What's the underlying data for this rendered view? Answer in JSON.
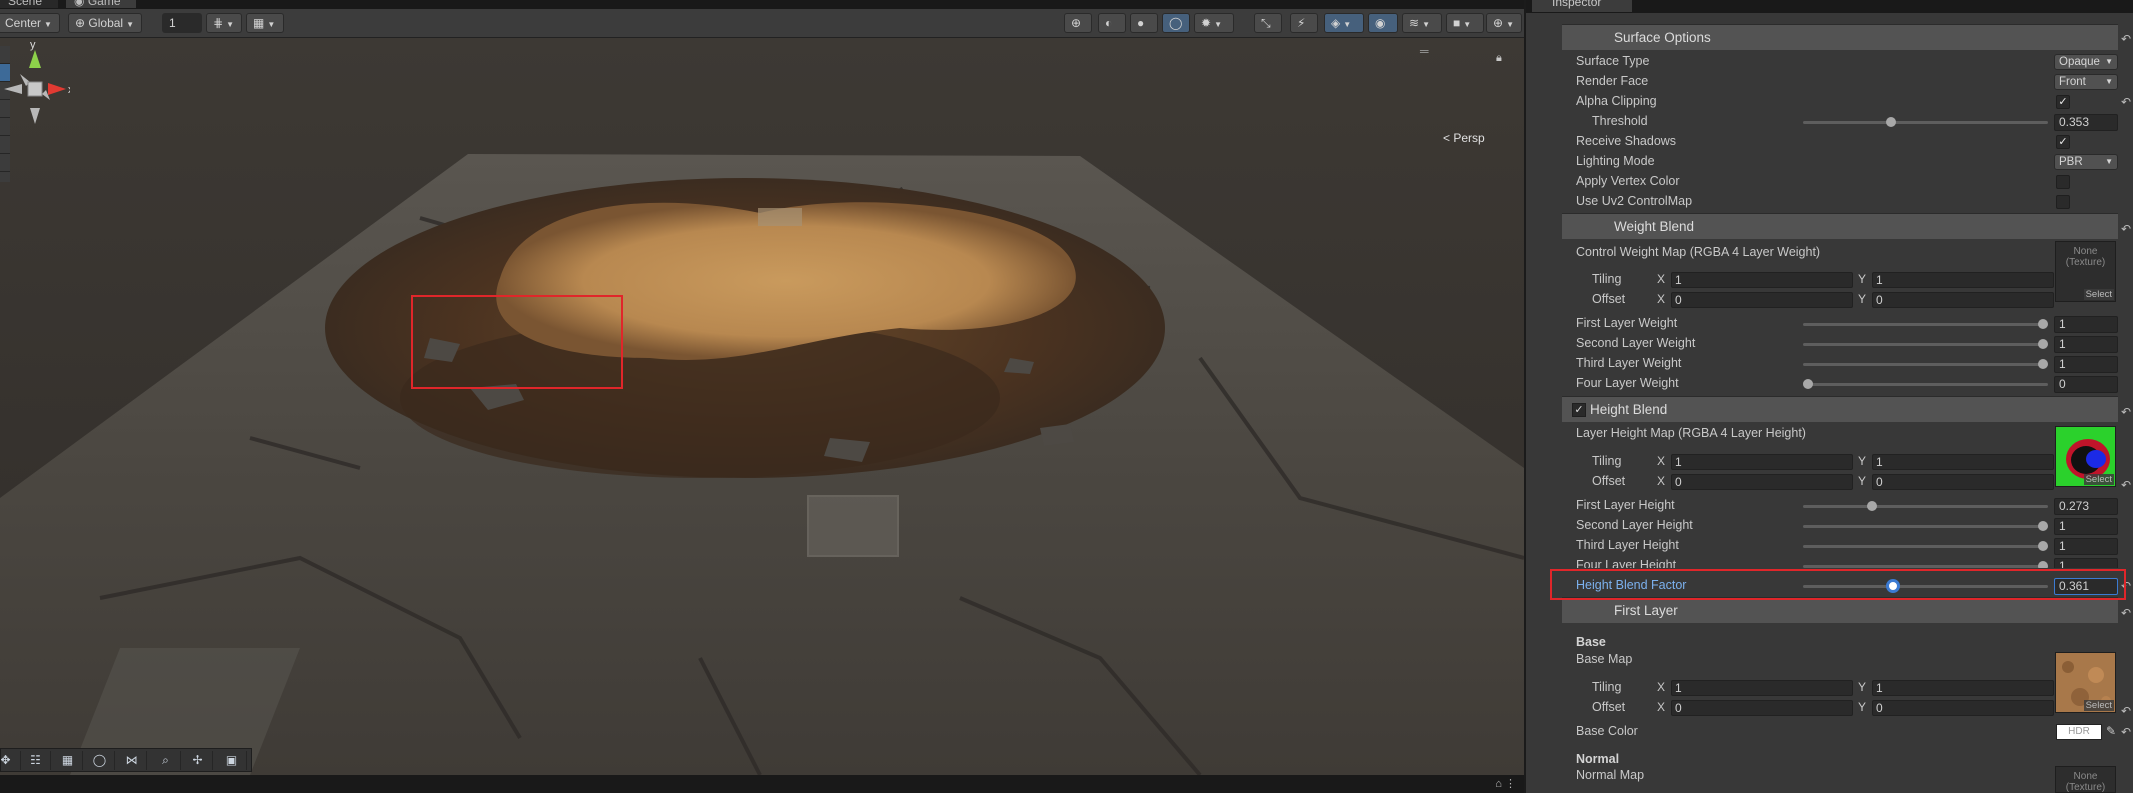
{
  "tabs": {
    "scene": "Scene",
    "game": "Game"
  },
  "toolbar": {
    "pivot": "Center",
    "space": "Global",
    "grid_value": "1"
  },
  "viewport": {
    "persp_label": "< Persp",
    "gizmo_y": "y",
    "gizmo_x": "x"
  },
  "inspector": {
    "tab": "Inspector",
    "surface_options": {
      "title": "Surface Options",
      "surface_type_label": "Surface Type",
      "surface_type_value": "Opaque",
      "render_face_label": "Render Face",
      "render_face_value": "Front",
      "alpha_clipping_label": "Alpha Clipping",
      "alpha_clipping_checked": "✓",
      "threshold_label": "Threshold",
      "threshold_value": "0.353",
      "threshold_fraction": 0.353,
      "receive_shadows_label": "Receive Shadows",
      "receive_shadows_checked": "✓",
      "lighting_mode_label": "Lighting Mode",
      "lighting_mode_value": "PBR",
      "apply_vertex_color_label": "Apply Vertex Color",
      "use_uv2_label": "Use Uv2 ControlMap"
    },
    "weight_blend": {
      "title": "Weight Blend",
      "control_map_label": "Control Weight Map (RGBA 4 Layer Weight)",
      "tex_none": "None",
      "tex_type": "(Texture)",
      "select": "Select",
      "tiling_label": "Tiling",
      "offset_label": "Offset",
      "x": "X",
      "y": "Y",
      "tiling_x": "1",
      "tiling_y": "1",
      "offset_x": "0",
      "offset_y": "0",
      "first_label": "First Layer Weight",
      "first_value": "1",
      "first_fraction": 1,
      "second_label": "Second Layer Weight",
      "second_value": "1",
      "second_fraction": 1,
      "third_label": "Third Layer Weight",
      "third_value": "1",
      "third_fraction": 1,
      "four_label": "Four Layer Weight",
      "four_value": "0",
      "four_fraction": 0
    },
    "height_blend": {
      "title": "Height Blend",
      "checked": "✓",
      "map_label": "Layer Height Map (RGBA 4 Layer Height)",
      "select": "Select",
      "tiling_label": "Tiling",
      "offset_label": "Offset",
      "x": "X",
      "y": "Y",
      "tiling_x": "1",
      "tiling_y": "1",
      "offset_x": "0",
      "offset_y": "0",
      "first_label": "First Layer Height",
      "first_value": "0.273",
      "first_fraction": 0.273,
      "second_label": "Second Layer Height",
      "second_value": "1",
      "second_fraction": 1,
      "third_label": "Third Layer Height",
      "third_value": "1",
      "third_fraction": 1,
      "four_label": "Four Layer Height",
      "four_value": "1",
      "four_fraction": 1,
      "factor_label": "Height Blend Factor",
      "factor_value": "0.361",
      "factor_fraction": 0.361
    },
    "first_layer": {
      "title": "First Layer",
      "base_heading": "Base",
      "base_map_label": "Base Map",
      "select": "Select",
      "tiling_label": "Tiling",
      "offset_label": "Offset",
      "x": "X",
      "y": "Y",
      "tiling_x": "1",
      "tiling_y": "1",
      "offset_x": "0",
      "offset_y": "0",
      "base_color_label": "Base Color",
      "hdr": "HDR",
      "normal_heading": "Normal",
      "normal_map_label": "Normal Map",
      "tex_none": "None",
      "tex_type": "(Texture)"
    }
  },
  "colors": {
    "accent": "#3b7ad2",
    "highlight": "#e0262a",
    "selected_text": "#7cb1ee"
  }
}
